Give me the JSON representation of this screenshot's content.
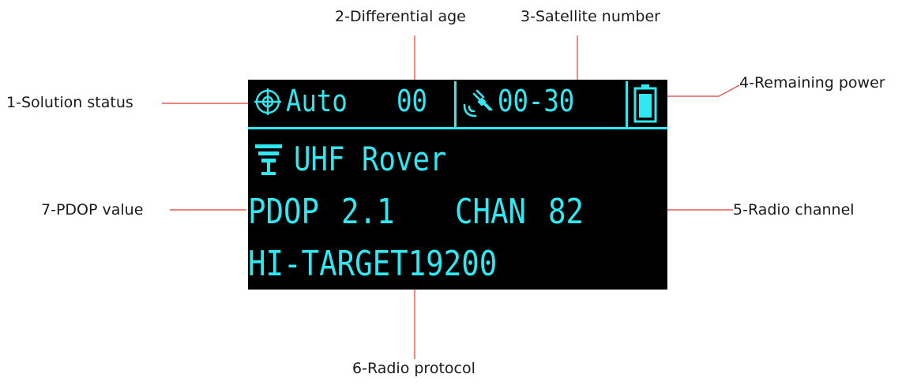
{
  "callouts": {
    "solution_status": "1-Solution status",
    "differential_age": "2-Differential age",
    "satellite_number": "3-Satellite number",
    "remaining_power": "4-Remaining power",
    "radio_channel": "5-Radio channel",
    "radio_protocol": "6-Radio protocol",
    "pdop_value": "7-PDOP value"
  },
  "screen": {
    "status_bar": {
      "solution_mode": "Auto",
      "differential_age": "00",
      "satellite_count": "00-30"
    },
    "mode_line": "UHF Rover",
    "pdop_label": "PDOP",
    "pdop_value": "2.1",
    "chan_label": "CHAN",
    "chan_value": "82",
    "protocol": "HI-TARGET19200"
  },
  "colors": {
    "screen_background": "#000000",
    "screen_text": "#2fe8f2",
    "leader_line": "#e63b2e",
    "callout_text": "#1a1a1a"
  },
  "icons": {
    "solution": "crosshair-target-icon",
    "satellite": "satellite-icon",
    "battery": "battery-icon",
    "antenna": "radio-antenna-icon"
  }
}
